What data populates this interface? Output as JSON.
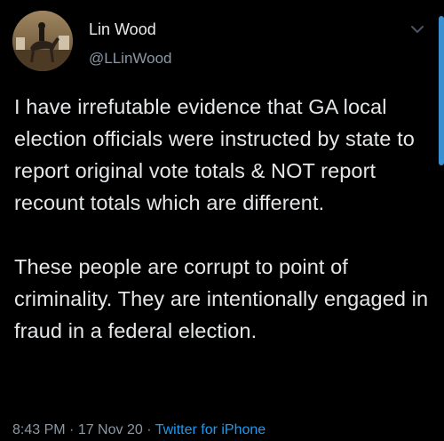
{
  "author": {
    "display_name": "Lin Wood",
    "handle": "@LLinWood",
    "avatar_icon": "avatar-horse-rider-icon"
  },
  "tweet": {
    "paragraph_1": "I have irrefutable evidence that GA local election officials were instructed by state to report original vote totals & NOT report recount totals which are different.",
    "paragraph_2": "These people are corrupt to point of criminality. They are intentionally engaged in fraud in a federal election."
  },
  "meta": {
    "time": "8:43 PM",
    "separator": " · ",
    "date": "17 Nov 20",
    "separator2": " · ",
    "source": "Twitter for iPhone"
  },
  "icons": {
    "menu": "chevron-down-icon"
  },
  "colors": {
    "background": "#000000",
    "text": "#e4e6e8",
    "secondary": "#8b98a5",
    "link": "#1d9bf0"
  }
}
